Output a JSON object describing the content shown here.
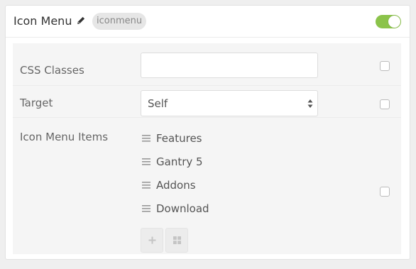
{
  "header": {
    "title": "Icon Menu",
    "badge": "iconmenu",
    "enabled": true
  },
  "fields": {
    "css_classes": {
      "label": "CSS Classes",
      "value": ""
    },
    "target": {
      "label": "Target",
      "selected": "Self"
    },
    "menu_items": {
      "label": "Icon Menu Items",
      "items": [
        "Features",
        "Gantry 5",
        "Addons",
        "Download"
      ]
    }
  },
  "icons": {
    "edit": "pencil-icon",
    "drag": "drag-handle-icon",
    "add": "plus-icon",
    "bulk": "grid-icon"
  },
  "colors": {
    "toggle_on": "#8bc34a"
  }
}
